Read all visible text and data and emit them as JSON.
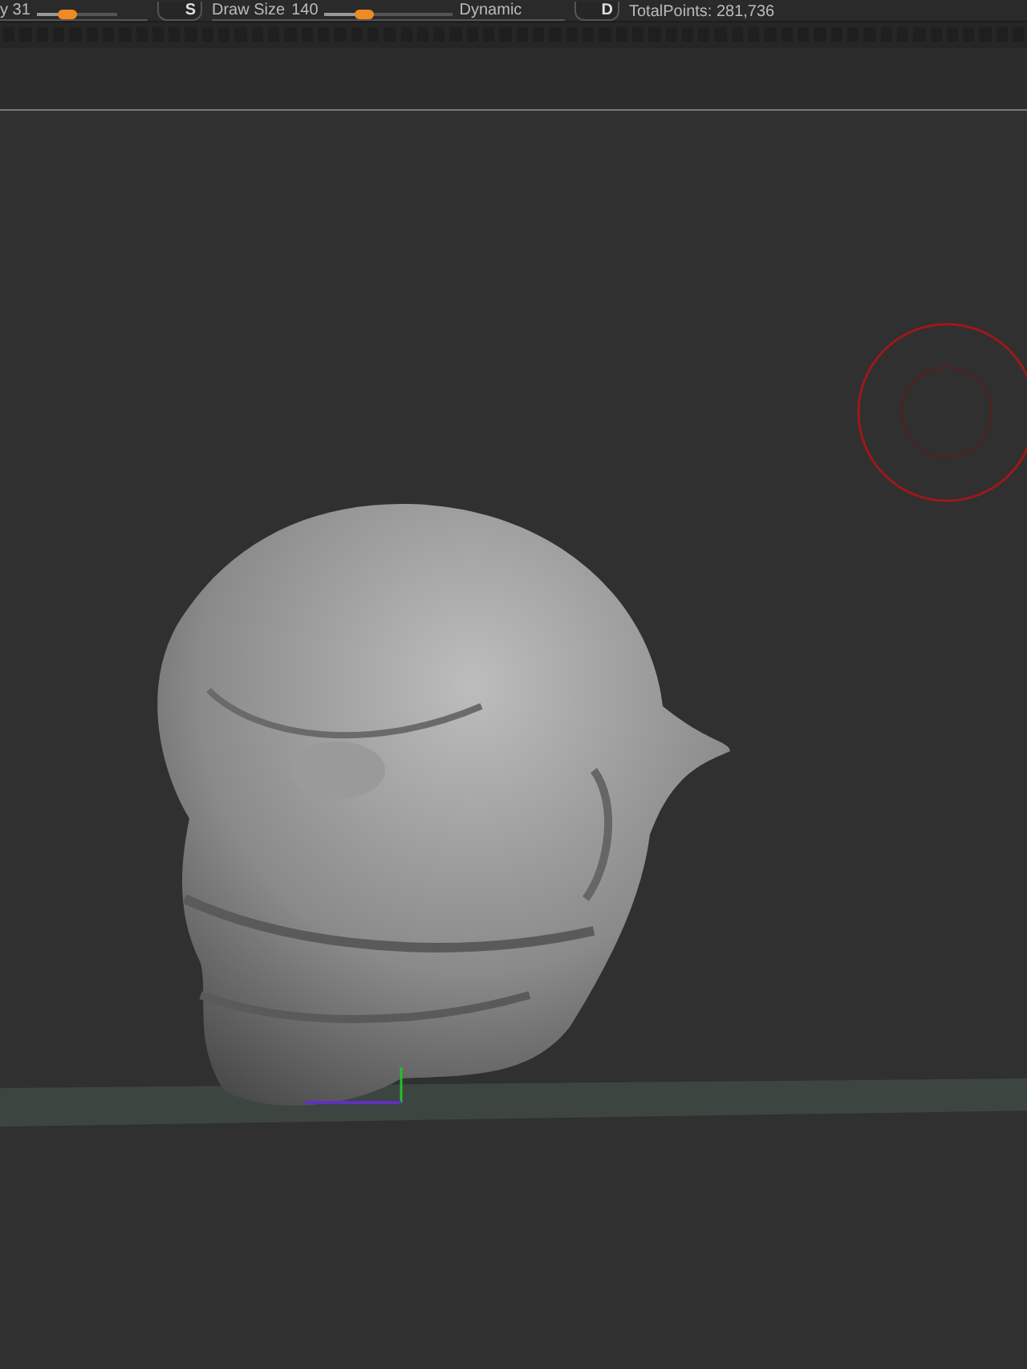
{
  "top_bar": {
    "intensity": {
      "label": "y 31",
      "level": 0.5
    },
    "s_button": "S",
    "draw_size": {
      "label": "Draw Size",
      "value": "140",
      "level": 0.39,
      "mode": "Dynamic"
    },
    "d_button": "D",
    "total_points": "TotalPoints: 281,736"
  }
}
